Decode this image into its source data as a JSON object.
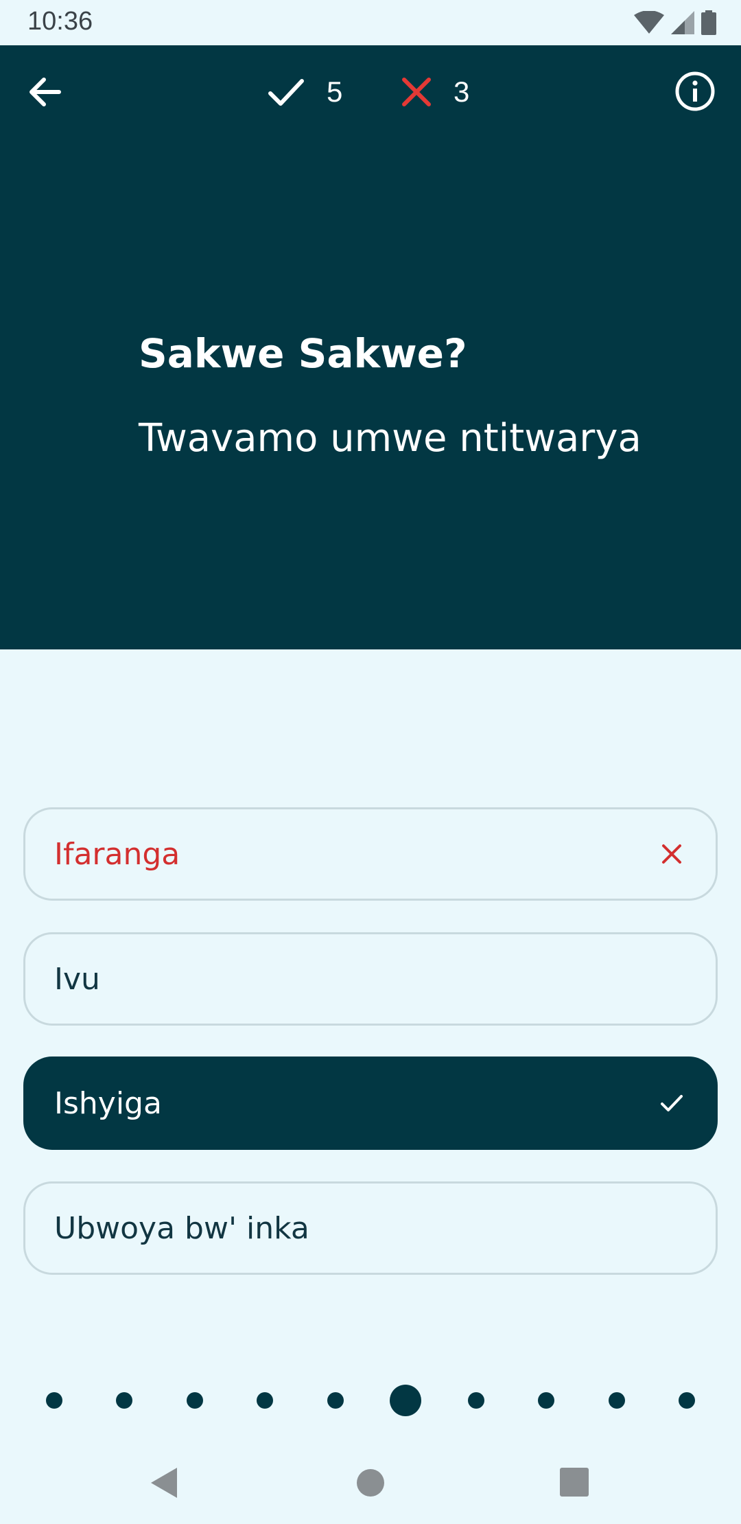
{
  "status_bar": {
    "time": "10:36",
    "icons": [
      "wifi-icon",
      "signal-icon",
      "battery-icon"
    ]
  },
  "header": {
    "back_icon": "arrow-left-icon",
    "score": {
      "correct": "5",
      "wrong": "3"
    },
    "info_icon": "info-icon"
  },
  "quiz": {
    "question": "Sakwe Sakwe?",
    "sentence": "Twavamo umwe ntitwarya"
  },
  "options": [
    {
      "label": "Ifaranga",
      "state": "wrong"
    },
    {
      "label": "Ivu",
      "state": "neutral"
    },
    {
      "label": "Ishyiga",
      "state": "correct"
    },
    {
      "label": "Ubwoya bw' inka",
      "state": "neutral"
    }
  ],
  "progress": {
    "total": 10,
    "current": 6
  },
  "colors": {
    "primary_dark": "#023743",
    "background": "#EAF8FC",
    "wrong": "#D32F2F",
    "white": "#FFFFFF"
  },
  "navbar": {
    "icons": [
      "nav-back-icon",
      "nav-home-icon",
      "nav-recents-icon"
    ]
  }
}
